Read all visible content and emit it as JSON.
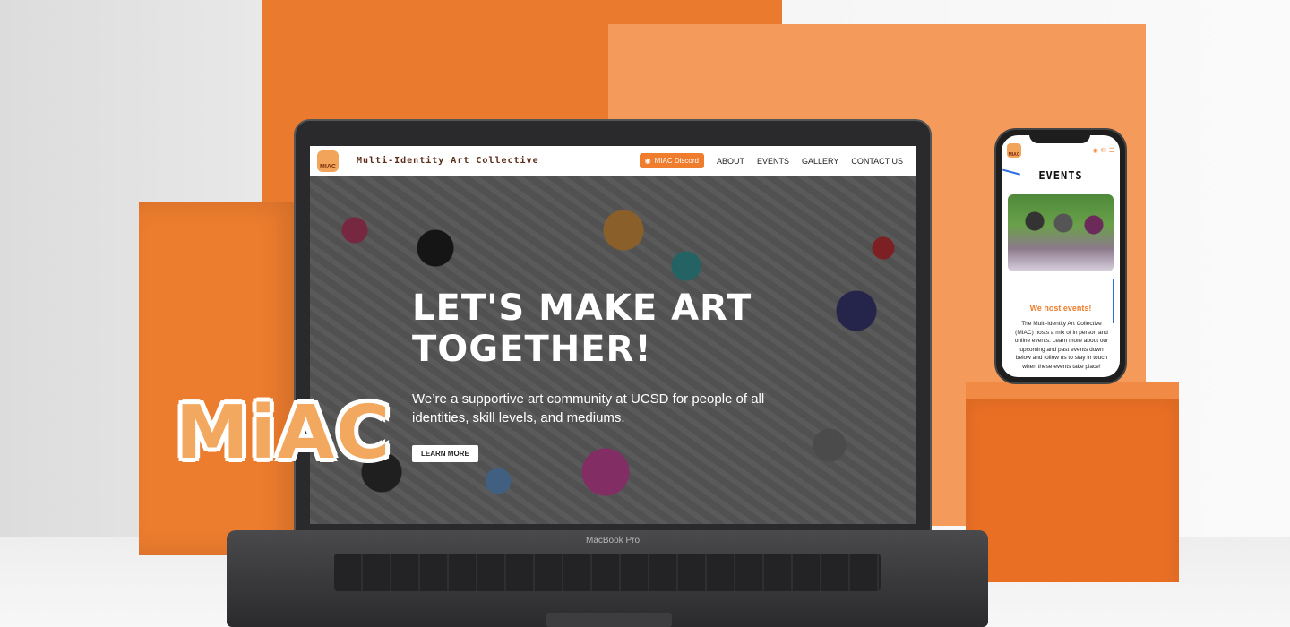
{
  "laptop": {
    "device_label": "MacBook Pro",
    "nav": {
      "logo_text": "MIAC",
      "site_title": "Multi-Identity Art Collective",
      "discord_button": "MIAC Discord",
      "links": [
        "ABOUT",
        "EVENTS",
        "GALLERY",
        "CONTACT US"
      ]
    },
    "hero": {
      "heading": "LET'S MAKE ART TOGETHER!",
      "subheading": "We’re a supportive art community at UCSD for people of all identities, skill levels, and mediums.",
      "button": "LEARN MORE"
    }
  },
  "brand": {
    "logo_text": "MiAC",
    "accent_color": "#ef7d2d"
  },
  "phone": {
    "logo_text": "MIAC",
    "page_title": "EVENTS",
    "subtitle": "We host events!",
    "body": "The Multi-Identity Art Collective (MIAC) hosts a mix of in person and online events. Learn more about our upcoming and past events down below and follow us to stay in touch when these events take place!",
    "icons": [
      "discord-icon",
      "mail-icon",
      "menu-icon"
    ]
  }
}
